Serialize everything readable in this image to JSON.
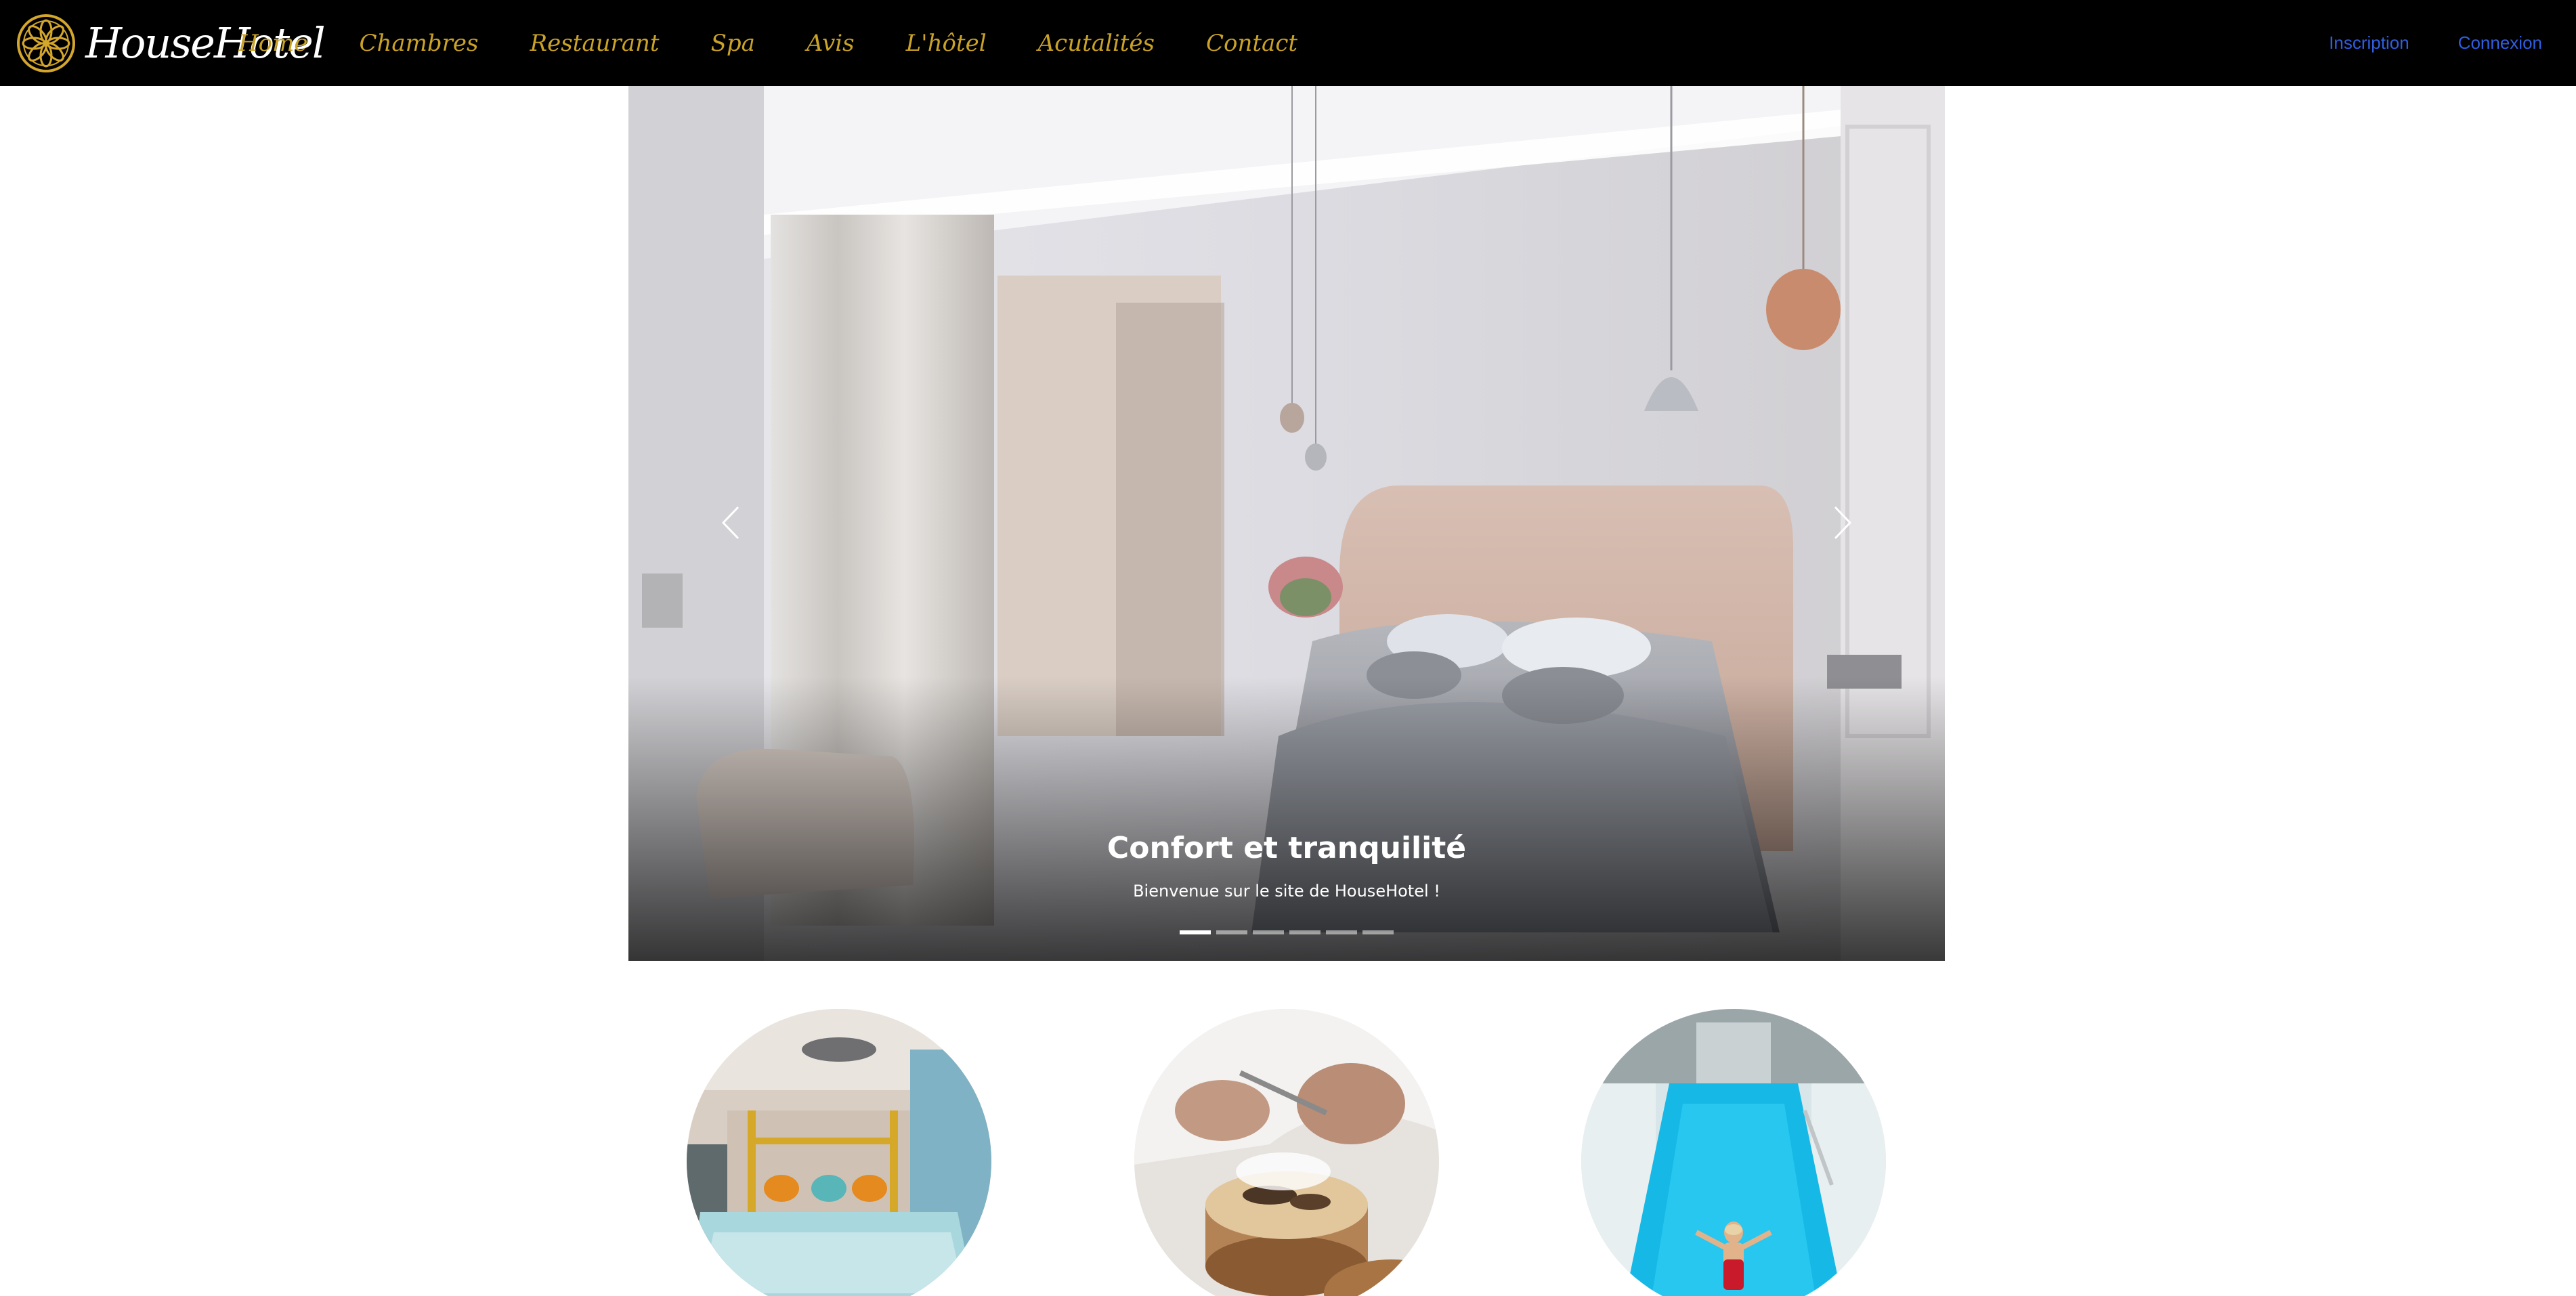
{
  "brand": {
    "name": "HouseHotel",
    "logo_icon": "flower-mandala-icon"
  },
  "nav": {
    "items": [
      {
        "label": "Home"
      },
      {
        "label": "Chambres"
      },
      {
        "label": "Restaurant"
      },
      {
        "label": "Spa"
      },
      {
        "label": "Avis"
      },
      {
        "label": "L'hôtel"
      },
      {
        "label": "Acutalités"
      },
      {
        "label": "Contact"
      }
    ]
  },
  "auth": {
    "signup_label": "Inscription",
    "login_label": "Connexion"
  },
  "hero": {
    "title": "Confort et tranquilité",
    "subtitle": "Bienvenue sur le site de HouseHotel !",
    "slide_count": 6,
    "active_slide": 1,
    "prev_icon": "chevron-left-icon",
    "next_icon": "chevron-right-icon"
  },
  "features": [
    {
      "name": "room",
      "image": "bedroom-photo"
    },
    {
      "name": "restaurant",
      "image": "chef-plating-photo"
    },
    {
      "name": "spa",
      "image": "swimming-pool-photo"
    }
  ],
  "colors": {
    "navbar_bg": "#000000",
    "nav_link": "#c9a227",
    "auth_link": "#2f5fe0",
    "page_bg": "#ffffff"
  }
}
